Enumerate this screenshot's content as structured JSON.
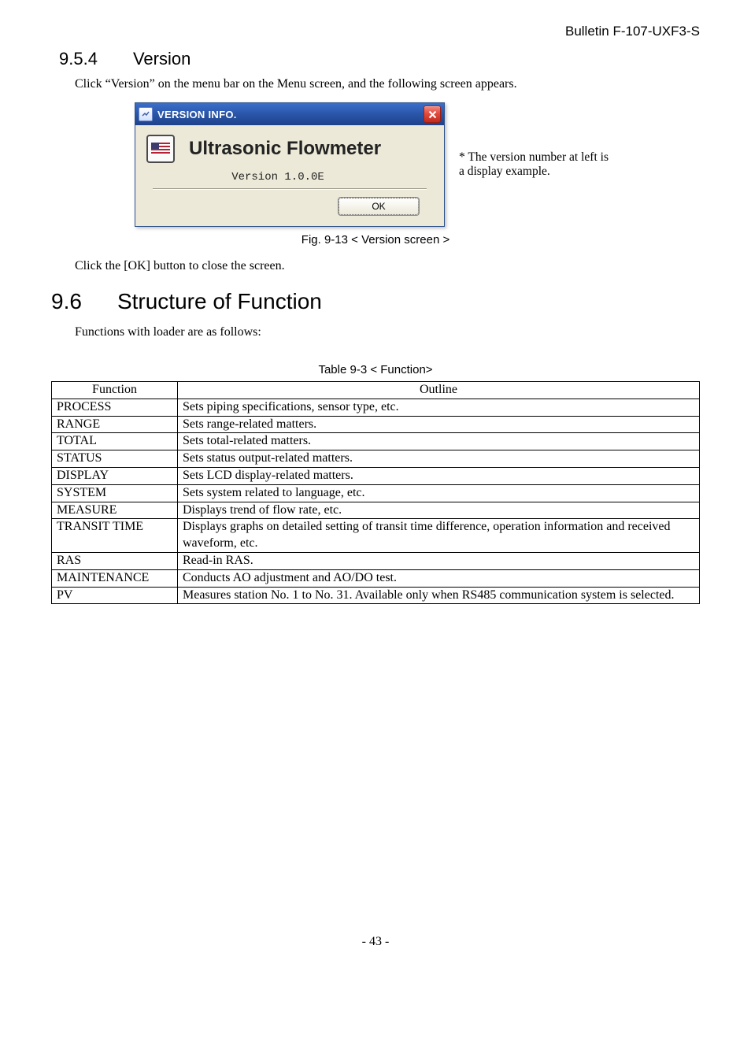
{
  "header": {
    "bulletin": "Bulletin F-107-UXF3-S"
  },
  "section954": {
    "number": "9.5.4",
    "title": "Version",
    "intro": "Click “Version” on the menu bar on the Menu screen, and the following screen appears.",
    "dialog": {
      "title": "VERSION INFO.",
      "appName": "Ultrasonic Flowmeter",
      "versionLine": "Version 1.0.0E",
      "okLabel": "OK"
    },
    "sideNote": "* The version number at left is a display example.",
    "figCaption": "Fig. 9-13 < Version screen >",
    "afterFig": "Click the [OK] button to close the screen."
  },
  "section96": {
    "number": "9.6",
    "title": "Structure of Function",
    "intro": "Functions with loader are as follows:",
    "tableCaption": "Table 9-3 < Function>",
    "tableHeaders": {
      "fn": "Function",
      "outline": "Outline"
    },
    "rows": [
      {
        "fn": "PROCESS",
        "outline": "Sets piping specifications, sensor type, etc."
      },
      {
        "fn": "RANGE",
        "outline": "Sets range-related matters."
      },
      {
        "fn": "TOTAL",
        "outline": "Sets total-related matters."
      },
      {
        "fn": "STATUS",
        "outline": "Sets status output-related matters."
      },
      {
        "fn": "DISPLAY",
        "outline": "Sets LCD display-related matters."
      },
      {
        "fn": "SYSTEM",
        "outline": "Sets system related to language, etc."
      },
      {
        "fn": "MEASURE",
        "outline": "Displays trend of flow rate, etc."
      },
      {
        "fn": "TRANSIT TIME",
        "outline": "Displays graphs on detailed setting of transit time difference, operation information and received waveform, etc."
      },
      {
        "fn": "RAS",
        "outline": "Read-in RAS."
      },
      {
        "fn": "MAINTENANCE",
        "outline": "Conducts AO adjustment and AO/DO test."
      },
      {
        "fn": "PV",
        "outline": "Measures station No. 1 to No. 31. Available only when RS485 communication system is selected."
      }
    ]
  },
  "footer": {
    "pageNum": "- 43 -"
  }
}
